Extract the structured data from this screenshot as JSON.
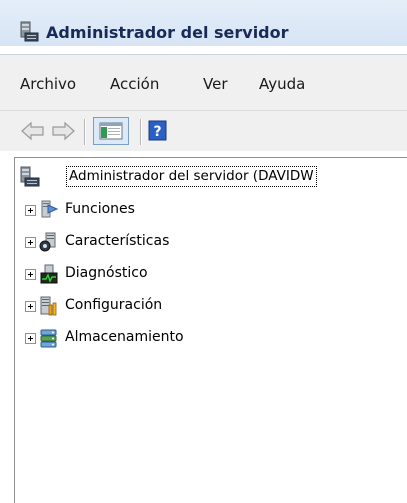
{
  "window": {
    "title": "Administrador del servidor",
    "title_icon": "server-manager-icon"
  },
  "menu": {
    "items": [
      {
        "label": "Archivo"
      },
      {
        "label": "Acción"
      },
      {
        "label": "Ver"
      },
      {
        "label": "Ayuda"
      }
    ]
  },
  "toolbar": {
    "buttons": [
      {
        "icon": "back-arrow-icon"
      },
      {
        "icon": "forward-arrow-icon"
      },
      {
        "icon": "show-hide-console-tree-icon"
      },
      {
        "icon": "help-icon"
      }
    ]
  },
  "tree": {
    "root": {
      "label": "Administrador del servidor (DAVIDW",
      "icon": "server-manager-icon"
    },
    "nodes": [
      {
        "label": "Funciones",
        "icon": "roles-icon"
      },
      {
        "label": "Características",
        "icon": "features-icon"
      },
      {
        "label": "Diagnóstico",
        "icon": "diagnostics-icon"
      },
      {
        "label": "Configuración",
        "icon": "configuration-icon"
      },
      {
        "label": "Almacenamiento",
        "icon": "storage-icon"
      }
    ]
  },
  "colors": {
    "title_text": "#1a2a57",
    "titlebar_bg": "#d6e4f4",
    "menubar_bg": "#f0f0f0"
  }
}
